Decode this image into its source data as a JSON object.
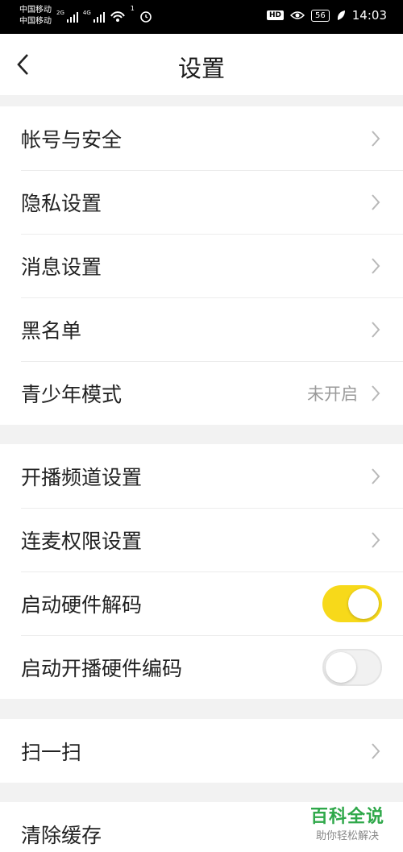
{
  "status_bar": {
    "carrier_1": "中国移动",
    "carrier_2": "中国移动",
    "net_1": "2G",
    "net_2": "4G",
    "wifi_badge": "1",
    "hd_badge": "HD",
    "battery": "56",
    "time": "14:03"
  },
  "header": {
    "title": "设置"
  },
  "groups": [
    {
      "items": [
        {
          "label": "帐号与安全"
        },
        {
          "label": "隐私设置"
        },
        {
          "label": "消息设置"
        },
        {
          "label": "黑名单"
        },
        {
          "label": "青少年模式",
          "value": "未开启"
        }
      ]
    },
    {
      "items": [
        {
          "label": "开播频道设置"
        },
        {
          "label": "连麦权限设置"
        },
        {
          "label": "启动硬件解码",
          "toggle": true
        },
        {
          "label": "启动开播硬件编码",
          "toggle": false
        }
      ]
    },
    {
      "items": [
        {
          "label": "扫一扫"
        }
      ]
    },
    {
      "items": [
        {
          "label": "清除缓存"
        }
      ]
    }
  ],
  "watermark": {
    "title": "百科全说",
    "subtitle": "助你轻松解决"
  },
  "colors": {
    "accent": "#f7d91a",
    "watermark": "#2fa84a"
  }
}
